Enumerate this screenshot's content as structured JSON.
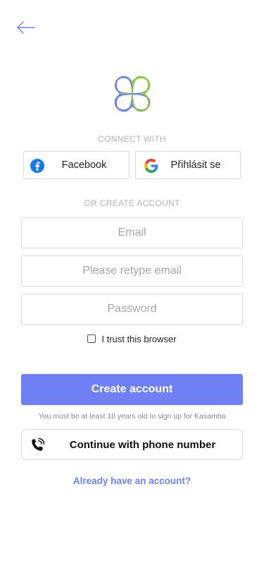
{
  "header": {
    "back_icon": "arrow-left-icon"
  },
  "brand": {
    "logo_icon": "kasamba-logo-icon",
    "colors": {
      "green": "#8cc63f",
      "blue": "#6f80f5"
    }
  },
  "connect": {
    "caption": "CONNECT WITH",
    "facebook_label": "Facebook",
    "google_label": "Přihlásit se"
  },
  "create": {
    "caption": "OR CREATE ACCOUNT",
    "email_placeholder": "Email",
    "retype_placeholder": "Please retype email",
    "password_placeholder": "Password",
    "trust_label": "I trust this browser",
    "trust_checked": false,
    "submit_label": "Create account",
    "age_note": "You must be at least 18 years old to sign up for Kasamba"
  },
  "phone": {
    "label": "Continue with phone number",
    "icon": "phone-icon"
  },
  "login_link": "Already have an account?",
  "colors": {
    "accent": "#6f80f5",
    "facebook": "#1877f2"
  }
}
